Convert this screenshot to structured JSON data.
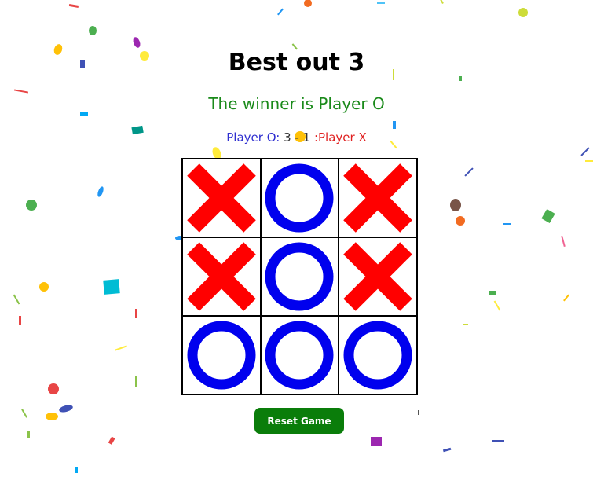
{
  "header": {
    "title": "Best out 3"
  },
  "status": {
    "winner_text": "The winner is Player O"
  },
  "score": {
    "player_o_label": "Player O:",
    "player_o_score": "3",
    "separator": "-",
    "player_x_score": "1",
    "player_x_label": ":Player X"
  },
  "board": {
    "cells": [
      "X",
      "O",
      "X",
      "X",
      "O",
      "X",
      "O",
      "O",
      "O"
    ]
  },
  "controls": {
    "reset_label": "Reset Game"
  },
  "colors": {
    "x_mark": "#ff0000",
    "o_mark": "#0000ee",
    "winner_text": "#1a8a1a",
    "player_o_text": "#2f2fd0",
    "player_x_text": "#e02020",
    "reset_button": "#0a7d0a"
  }
}
